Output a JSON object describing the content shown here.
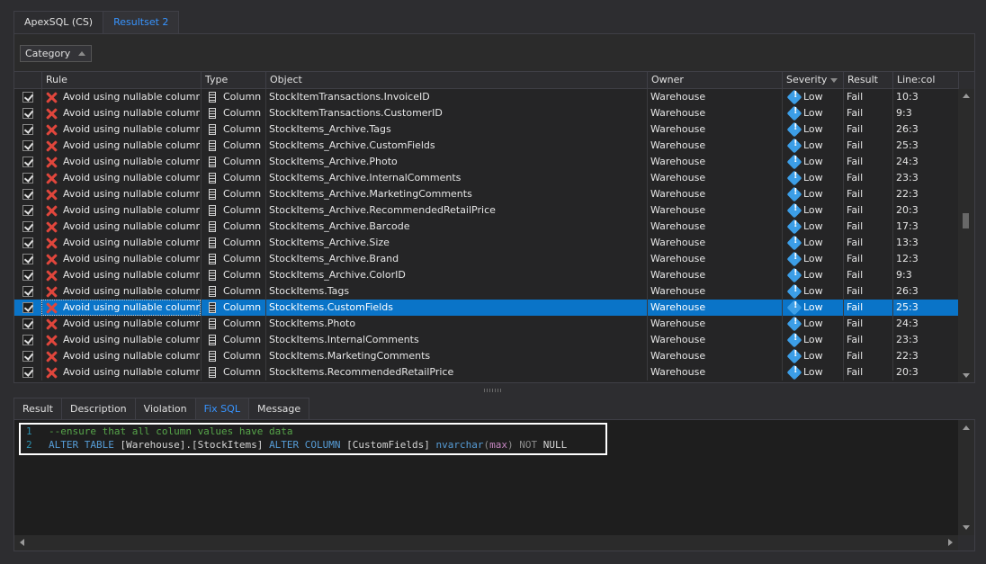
{
  "top_tabs": [
    {
      "label": "ApexSQL (CS)",
      "active": false
    },
    {
      "label": "Resultset 2",
      "active": true
    }
  ],
  "group_by": {
    "label": "Category"
  },
  "grid": {
    "columns": [
      "Rule",
      "Type",
      "Object",
      "Owner",
      "Severity",
      "Result",
      "Line:col"
    ],
    "selected_row": 13,
    "rows": [
      {
        "checked": true,
        "rule": "Avoid using nullable columns",
        "type": "Column",
        "object": "StockItemTransactions.InvoiceID",
        "owner": "Warehouse",
        "severity": "Low",
        "result": "Fail",
        "linecol": "10:3"
      },
      {
        "checked": true,
        "rule": "Avoid using nullable columns",
        "type": "Column",
        "object": "StockItemTransactions.CustomerID",
        "owner": "Warehouse",
        "severity": "Low",
        "result": "Fail",
        "linecol": "9:3"
      },
      {
        "checked": true,
        "rule": "Avoid using nullable columns",
        "type": "Column",
        "object": "StockItems_Archive.Tags",
        "owner": "Warehouse",
        "severity": "Low",
        "result": "Fail",
        "linecol": "26:3"
      },
      {
        "checked": true,
        "rule": "Avoid using nullable columns",
        "type": "Column",
        "object": "StockItems_Archive.CustomFields",
        "owner": "Warehouse",
        "severity": "Low",
        "result": "Fail",
        "linecol": "25:3"
      },
      {
        "checked": true,
        "rule": "Avoid using nullable columns",
        "type": "Column",
        "object": "StockItems_Archive.Photo",
        "owner": "Warehouse",
        "severity": "Low",
        "result": "Fail",
        "linecol": "24:3"
      },
      {
        "checked": true,
        "rule": "Avoid using nullable columns",
        "type": "Column",
        "object": "StockItems_Archive.InternalComments",
        "owner": "Warehouse",
        "severity": "Low",
        "result": "Fail",
        "linecol": "23:3"
      },
      {
        "checked": true,
        "rule": "Avoid using nullable columns",
        "type": "Column",
        "object": "StockItems_Archive.MarketingComments",
        "owner": "Warehouse",
        "severity": "Low",
        "result": "Fail",
        "linecol": "22:3"
      },
      {
        "checked": true,
        "rule": "Avoid using nullable columns",
        "type": "Column",
        "object": "StockItems_Archive.RecommendedRetailPrice",
        "owner": "Warehouse",
        "severity": "Low",
        "result": "Fail",
        "linecol": "20:3"
      },
      {
        "checked": true,
        "rule": "Avoid using nullable columns",
        "type": "Column",
        "object": "StockItems_Archive.Barcode",
        "owner": "Warehouse",
        "severity": "Low",
        "result": "Fail",
        "linecol": "17:3"
      },
      {
        "checked": true,
        "rule": "Avoid using nullable columns",
        "type": "Column",
        "object": "StockItems_Archive.Size",
        "owner": "Warehouse",
        "severity": "Low",
        "result": "Fail",
        "linecol": "13:3"
      },
      {
        "checked": true,
        "rule": "Avoid using nullable columns",
        "type": "Column",
        "object": "StockItems_Archive.Brand",
        "owner": "Warehouse",
        "severity": "Low",
        "result": "Fail",
        "linecol": "12:3"
      },
      {
        "checked": true,
        "rule": "Avoid using nullable columns",
        "type": "Column",
        "object": "StockItems_Archive.ColorID",
        "owner": "Warehouse",
        "severity": "Low",
        "result": "Fail",
        "linecol": "9:3"
      },
      {
        "checked": true,
        "rule": "Avoid using nullable columns",
        "type": "Column",
        "object": "StockItems.Tags",
        "owner": "Warehouse",
        "severity": "Low",
        "result": "Fail",
        "linecol": "26:3"
      },
      {
        "checked": true,
        "rule": "Avoid using nullable columns",
        "type": "Column",
        "object": "StockItems.CustomFields",
        "owner": "Warehouse",
        "severity": "Low",
        "result": "Fail",
        "linecol": "25:3"
      },
      {
        "checked": true,
        "rule": "Avoid using nullable columns",
        "type": "Column",
        "object": "StockItems.Photo",
        "owner": "Warehouse",
        "severity": "Low",
        "result": "Fail",
        "linecol": "24:3"
      },
      {
        "checked": true,
        "rule": "Avoid using nullable columns",
        "type": "Column",
        "object": "StockItems.InternalComments",
        "owner": "Warehouse",
        "severity": "Low",
        "result": "Fail",
        "linecol": "23:3"
      },
      {
        "checked": true,
        "rule": "Avoid using nullable columns",
        "type": "Column",
        "object": "StockItems.MarketingComments",
        "owner": "Warehouse",
        "severity": "Low",
        "result": "Fail",
        "linecol": "22:3"
      },
      {
        "checked": true,
        "rule": "Avoid using nullable columns",
        "type": "Column",
        "object": "StockItems.RecommendedRetailPrice",
        "owner": "Warehouse",
        "severity": "Low",
        "result": "Fail",
        "linecol": "20:3"
      }
    ]
  },
  "bottom_tabs": [
    {
      "label": "Result",
      "active": false
    },
    {
      "label": "Description",
      "active": false
    },
    {
      "label": "Violation",
      "active": false
    },
    {
      "label": "Fix SQL",
      "active": true
    },
    {
      "label": "Message",
      "active": false
    }
  ],
  "editor": {
    "lines": [
      {
        "num": "1",
        "tokens": [
          {
            "t": "--ensure that all column values have data",
            "c": "cmt"
          }
        ]
      },
      {
        "num": "2",
        "tokens": [
          {
            "t": "ALTER TABLE ",
            "c": "kw"
          },
          {
            "t": "[Warehouse].[StockItems] ",
            "c": "idf"
          },
          {
            "t": "ALTER COLUMN ",
            "c": "kw"
          },
          {
            "t": "[CustomFields] ",
            "c": "idf"
          },
          {
            "t": "nvarchar",
            "c": "kw"
          },
          {
            "t": "(",
            "c": "dim"
          },
          {
            "t": "max",
            "c": "fn"
          },
          {
            "t": ") ",
            "c": "dim"
          },
          {
            "t": "NOT ",
            "c": "dim"
          },
          {
            "t": "NULL",
            "c": "idf"
          }
        ]
      }
    ]
  },
  "colors": {
    "accent": "#3794ff",
    "selection": "#0a74c8",
    "error": "#e0463c",
    "severity_low": "#3c9ee7"
  },
  "icons": {
    "rule": "error-x-icon",
    "type": "column-icon",
    "severity": "info-diamond-icon"
  }
}
